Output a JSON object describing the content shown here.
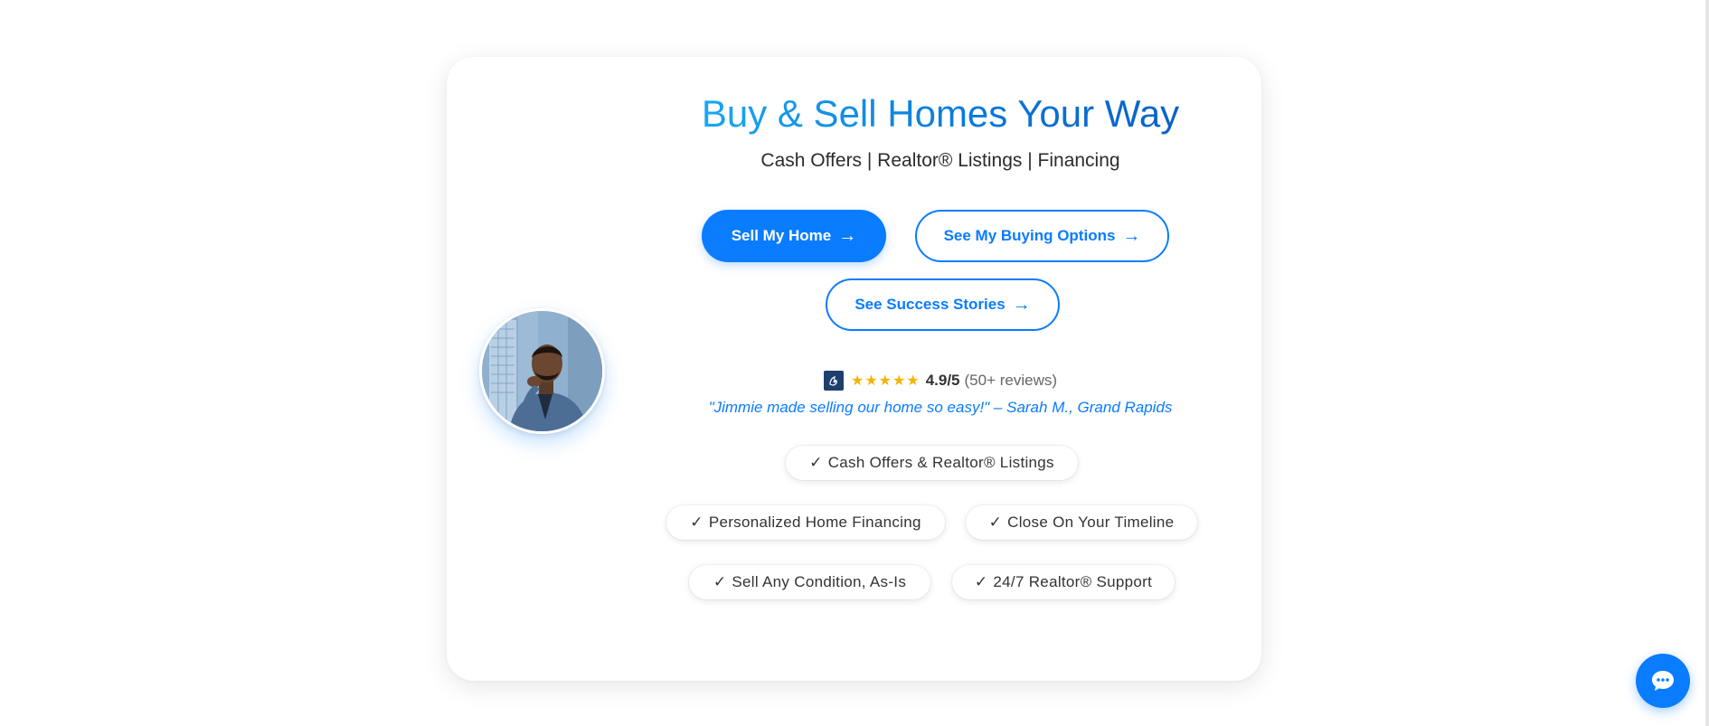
{
  "hero": {
    "title": "Buy & Sell Homes Your Way",
    "subtitle": "Cash Offers | Realtor® Listings | Financing"
  },
  "buttons": {
    "sell_label": "Sell My Home",
    "buy_label": "See My Buying Options",
    "stories_label": "See Success Stories",
    "arrow": "→"
  },
  "rating": {
    "stars": "★★★★★",
    "score": "4.9/5",
    "count": "(50+ reviews)"
  },
  "testimonial": "\"Jimmie made selling our home so easy!\" – Sarah M., Grand Rapids",
  "features": [
    {
      "check": "✓",
      "label": "Cash Offers & Realtor® Listings"
    },
    {
      "check": "✓",
      "label": "Personalized Home Financing"
    },
    {
      "check": "✓",
      "label": "Close On Your Timeline"
    },
    {
      "check": "✓",
      "label": "Sell Any Condition, As-Is"
    },
    {
      "check": "✓",
      "label": "24/7 Realtor® Support"
    }
  ],
  "colors": {
    "accent": "#0a7cff",
    "star": "#f5b400",
    "badge": "#1f3f6e"
  },
  "icons": {
    "chat": "chat-bubble-icon",
    "review": "review-badge-icon",
    "arrow": "arrow-right-icon"
  }
}
